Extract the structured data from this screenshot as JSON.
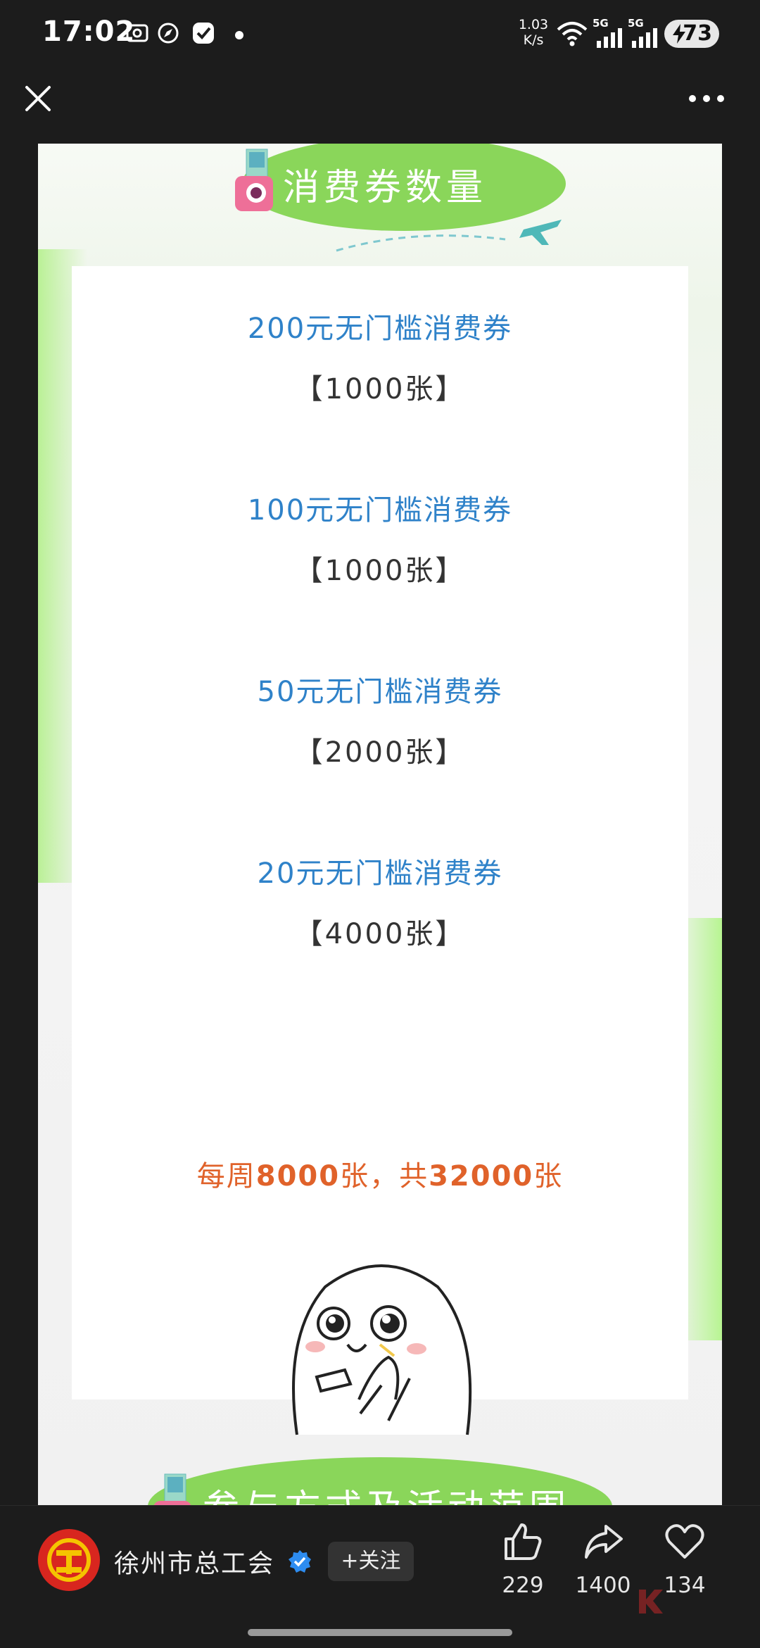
{
  "status_bar": {
    "time": "17:02",
    "net_speed_value": "1.03",
    "net_speed_unit": "K/s",
    "signal_1": "5G",
    "signal_2": "5G",
    "battery": "73"
  },
  "article": {
    "section_title": "消费券数量",
    "coupons": [
      {
        "name": "200元无门槛消费券",
        "count": "【1000张】"
      },
      {
        "name": "100元无门槛消费券",
        "count": "【1000张】"
      },
      {
        "name": "50元无门槛消费券",
        "count": "【2000张】"
      },
      {
        "name": "20元无门槛消费券",
        "count": "【4000张】"
      }
    ],
    "summary": {
      "p1": "每周",
      "p2": "8000",
      "p3": "张，共",
      "p4": "32000",
      "p5": "张"
    },
    "next_section_title": "参与方式及活动范围"
  },
  "bottom_bar": {
    "account_name": "徐州市总工会",
    "follow_label": "+关注",
    "likes": "229",
    "shares": "1400",
    "favorites": "134"
  },
  "colors": {
    "coupon_blue": "#2f82c9",
    "summary_orange": "#e0622a",
    "title_green": "#8ad65a"
  }
}
